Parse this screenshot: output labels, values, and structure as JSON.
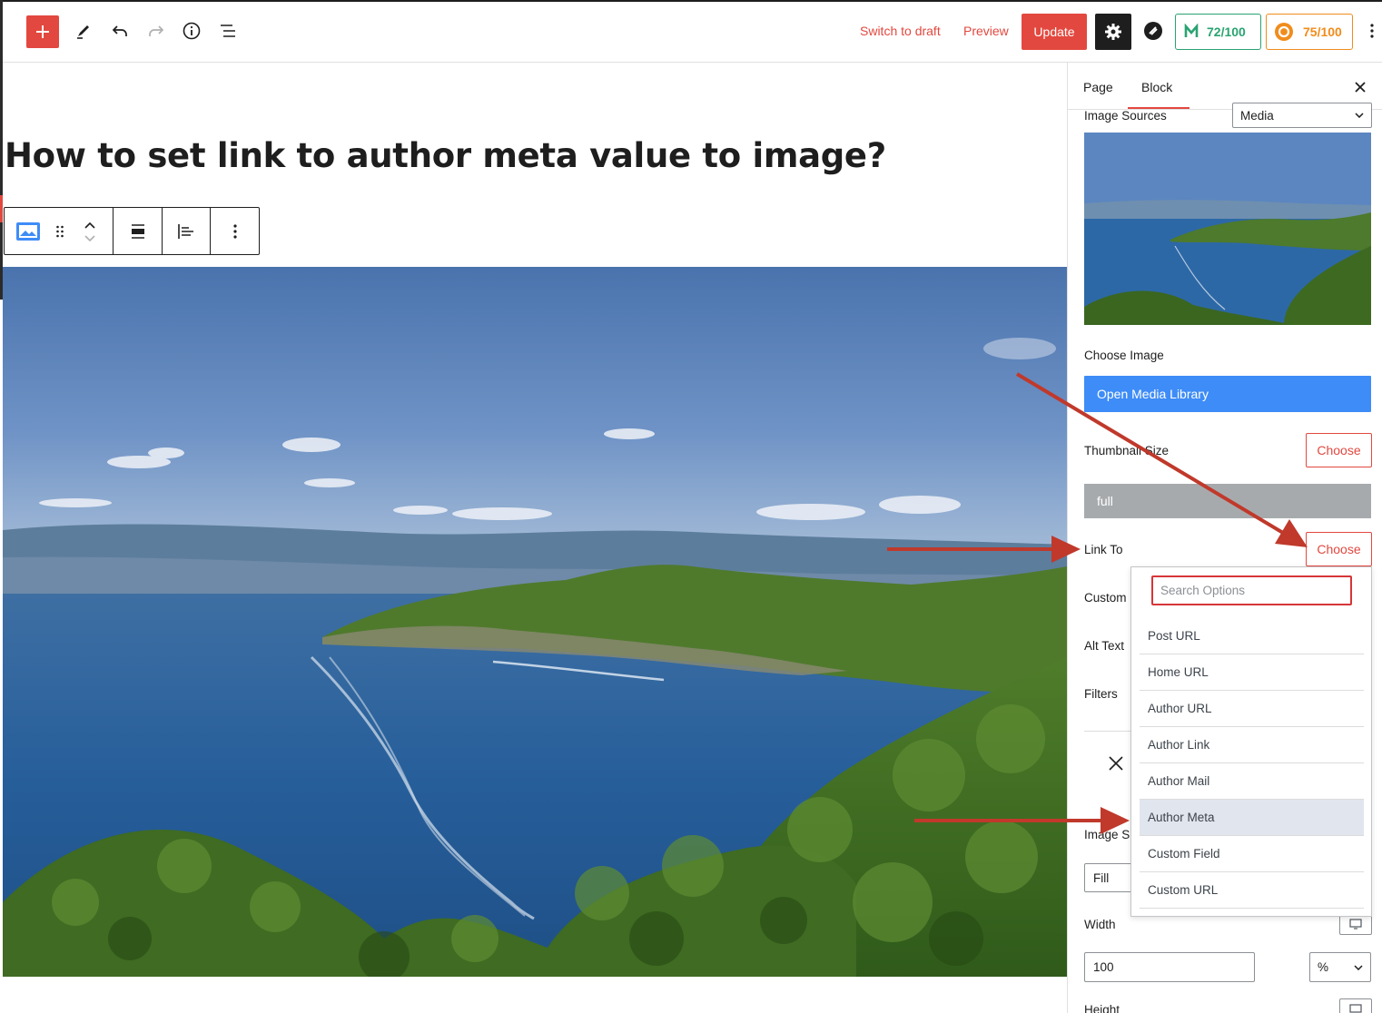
{
  "topbar": {
    "switch_to_draft": "Switch to draft",
    "preview": "Preview",
    "update": "Update",
    "score_seo": "72/100",
    "score_readability": "75/100"
  },
  "editor": {
    "post_title": "How to set link to author meta value to image?"
  },
  "sidebar": {
    "tab_page": "Page",
    "tab_block": "Block",
    "image_sources_label": "Image Sources",
    "image_sources_value": "Media",
    "choose_image_label": "Choose Image",
    "open_media_library": "Open Media Library",
    "thumbnail_size_label": "Thumbnail Size",
    "thumbnail_choose": "Choose",
    "thumbnail_value": "full",
    "link_to_label": "Link To",
    "link_to_choose": "Choose",
    "custom_label": "Custom",
    "alt_text_label": "Alt Text",
    "filters_label": "Filters",
    "image_size_label": "Image S",
    "fit_value": "Fill",
    "width_label": "Width",
    "width_value": "100",
    "width_unit": "%",
    "height_label": "Height"
  },
  "dropdown": {
    "search_placeholder": "Search Options",
    "options": [
      "Post URL",
      "Home URL",
      "Author URL",
      "Author Link",
      "Author Mail",
      "Author Meta",
      "Custom Field",
      "Custom URL"
    ],
    "highlighted": "Author Meta"
  },
  "colors": {
    "accent_red": "#e2483f",
    "primary_blue": "#3e8cf7",
    "seo_green": "#2aa372",
    "readability_orange": "#f08c1c",
    "annotation_arrow": "#c0392b"
  }
}
